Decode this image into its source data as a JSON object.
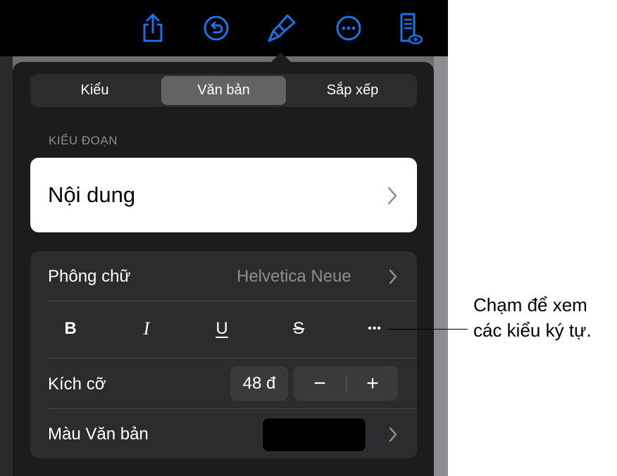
{
  "colors": {
    "accent": "#1a73e8",
    "toolbar_bg": "#000000",
    "popover_bg": "#1c1c1e",
    "text_color_swatch": "#000000"
  },
  "toolbar": {
    "icons": [
      "share-icon",
      "undo-icon",
      "format-brush-icon",
      "more-icon",
      "reader-view-icon"
    ]
  },
  "tabs": [
    {
      "label": "Kiểu",
      "active": false
    },
    {
      "label": "Văn bản",
      "active": true
    },
    {
      "label": "Sắp xếp",
      "active": false
    }
  ],
  "paragraph_style": {
    "section_title": "KIỂU ĐOẠN",
    "value": "Nội dung"
  },
  "font": {
    "label": "Phông chữ",
    "value": "Helvetica Neue"
  },
  "format_buttons": {
    "bold": "B",
    "italic": "I",
    "underline": "U",
    "strikethrough": "S",
    "more": "•••"
  },
  "size": {
    "label": "Kích cỡ",
    "value": "48 đ",
    "decrease": "−",
    "increase": "+"
  },
  "text_color": {
    "label": "Màu Văn bản"
  },
  "callout": {
    "line1": "Chạm để xem",
    "line2": "các kiểu ký tự."
  }
}
